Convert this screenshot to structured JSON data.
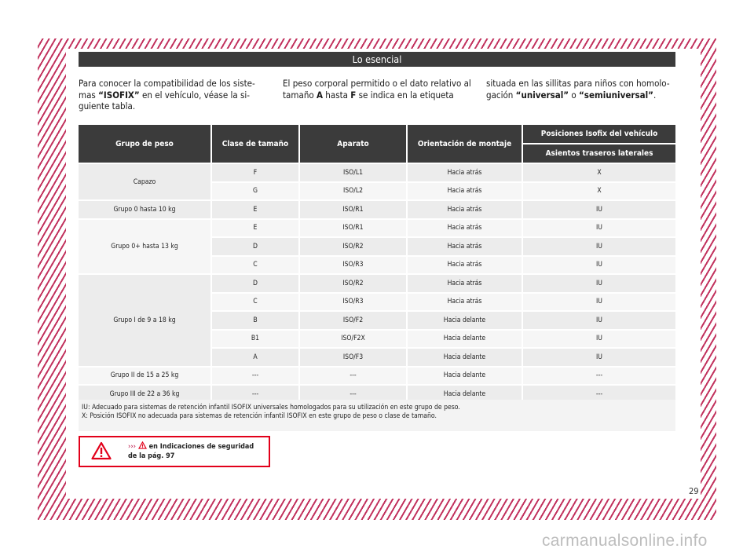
{
  "header": {
    "title": "Lo esencial"
  },
  "intro": {
    "col1": {
      "pre": "Para conocer la compatibilidad de los siste-mas ",
      "strong": "“ISOFIX”",
      "post": " en el vehículo, véase la si-guiente tabla."
    },
    "col2": {
      "pre": "El peso corporal permitido o el dato relativo al tamaño ",
      "a": "A",
      "mid": " hasta ",
      "f": "F",
      "post": " se indica en la etiqueta"
    },
    "col3": {
      "pre": "situada en las sillitas para niños con homolo-gación ",
      "universal": "“universal”",
      "mid": " o ",
      "semi": "“semiuniversal”",
      "post": "."
    }
  },
  "table": {
    "headers": [
      "Grupo de peso",
      "Clase de tamaño",
      "Aparato",
      "Orientación de montaje"
    ],
    "positions_header": "Posiciones Isofix del vehículo",
    "positions_sub": "Asientos traseros laterales",
    "groups": [
      {
        "name": "Capazo",
        "rows": [
          [
            "F",
            "ISO/L1",
            "Hacia atrás",
            "X"
          ],
          [
            "G",
            "ISO/L2",
            "Hacia atrás",
            "X"
          ]
        ]
      },
      {
        "name": "Grupo 0 hasta 10 kg",
        "rows": [
          [
            "E",
            "ISO/R1",
            "Hacia atrás",
            "IU"
          ]
        ]
      },
      {
        "name": "Grupo 0+ hasta 13 kg",
        "rows": [
          [
            "E",
            "ISO/R1",
            "Hacia atrás",
            "IU"
          ],
          [
            "D",
            "ISO/R2",
            "Hacia atrás",
            "IU"
          ],
          [
            "C",
            "ISO/R3",
            "Hacia atrás",
            "IU"
          ]
        ]
      },
      {
        "name": "Grupo I de 9 a 18 kg",
        "rows": [
          [
            "D",
            "ISO/R2",
            "Hacia atrás",
            "IU"
          ],
          [
            "C",
            "ISO/R3",
            "Hacia atrás",
            "IU"
          ],
          [
            "B",
            "ISO/F2",
            "Hacia delante",
            "IU"
          ],
          [
            "B1",
            "ISO/F2X",
            "Hacia delante",
            "IU"
          ],
          [
            "A",
            "ISO/F3",
            "Hacia delante",
            "IU"
          ]
        ]
      },
      {
        "name": "Grupo II de 15 a 25 kg",
        "rows": [
          [
            "---",
            "---",
            "Hacia delante",
            "---"
          ]
        ]
      },
      {
        "name": "Grupo III de 22 a 36 kg",
        "rows": [
          [
            "---",
            "---",
            "Hacia delante",
            "---"
          ]
        ]
      }
    ]
  },
  "legend": {
    "iu": "IU: Adecuado para sistemas de retención infantil ISOFIX universales homologados para su utilización en este grupo de peso.",
    "x": "X: Posición ISOFIX no adecuada para sistemas de retención infantil ISOFIX en este grupo de peso o clase de tamaño."
  },
  "warning": {
    "arrows": "›››",
    "text": " en Indicaciones de seguridad de la pág. 97"
  },
  "page_number": "29",
  "watermark": "carmanualsonline.info",
  "colors": {
    "accent": "#c2325e",
    "header": "#3b3b3b",
    "warning": "#e2001a"
  }
}
